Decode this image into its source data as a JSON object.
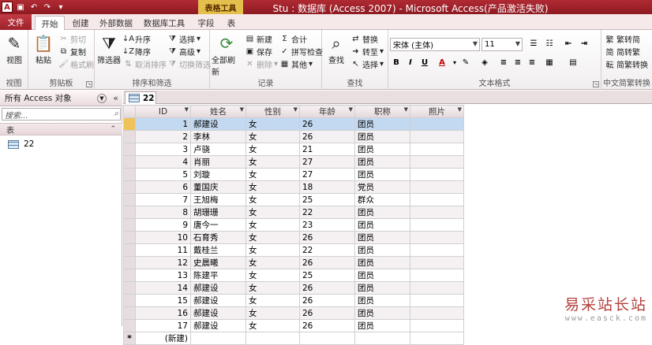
{
  "titlebar": {
    "context_tab": "表格工具",
    "title": "Stu : 数据库 (Access 2007) - Microsoft Access(产品激活失败)"
  },
  "tabs": [
    "文件",
    "开始",
    "创建",
    "外部数据",
    "数据库工具",
    "字段",
    "表"
  ],
  "ribbon": {
    "views": {
      "label": "视图",
      "btn": "视图"
    },
    "clipboard": {
      "label": "剪贴板",
      "paste": "粘贴",
      "cut": "剪切",
      "copy": "复制",
      "format_painter": "格式刷"
    },
    "sort_filter": {
      "label": "排序和筛选",
      "filter": "筛选器",
      "ascending": "升序",
      "descending": "降序",
      "remove_sort": "取消排序",
      "selection": "选择",
      "advanced": "高级",
      "toggle_filter": "切换筛选"
    },
    "records": {
      "label": "记录",
      "refresh_all": "全部刷新",
      "new": "新建",
      "save": "保存",
      "delete": "删除",
      "totals": "合计",
      "spelling": "拼写检查",
      "more": "其他"
    },
    "find": {
      "label": "查找",
      "find": "查找",
      "replace": "替换",
      "goto": "转至",
      "select": "选择"
    },
    "text_format": {
      "label": "文本格式",
      "font": "宋体 (主体)",
      "size": "11"
    },
    "chinese_conv": {
      "label": "中文简繁转换",
      "t2s": "繁转简",
      "s2t": "简转繁",
      "convert": "简繁转换"
    }
  },
  "navpane": {
    "header": "所有 Access 对象",
    "search_placeholder": "搜索...",
    "section": "表",
    "item": "22"
  },
  "document": {
    "tab": "22",
    "columns": [
      "ID",
      "姓名",
      "性别",
      "年龄",
      "职称",
      "照片"
    ],
    "rows": [
      [
        "1",
        "郝建设",
        "女",
        "26",
        "团员",
        ""
      ],
      [
        "2",
        "李林",
        "女",
        "26",
        "团员",
        ""
      ],
      [
        "3",
        "卢骁",
        "女",
        "21",
        "团员",
        ""
      ],
      [
        "4",
        "肖丽",
        "女",
        "27",
        "团员",
        ""
      ],
      [
        "5",
        "刘璇",
        "女",
        "27",
        "团员",
        ""
      ],
      [
        "6",
        "董国庆",
        "女",
        "18",
        "党员",
        ""
      ],
      [
        "7",
        "王旭梅",
        "女",
        "25",
        "群众",
        ""
      ],
      [
        "8",
        "胡珊珊",
        "女",
        "22",
        "团员",
        ""
      ],
      [
        "9",
        "唐今一",
        "女",
        "23",
        "团员",
        ""
      ],
      [
        "10",
        "石育秀",
        "女",
        "26",
        "团员",
        ""
      ],
      [
        "11",
        "戴桂兰",
        "女",
        "22",
        "团员",
        ""
      ],
      [
        "12",
        "史晨曦",
        "女",
        "26",
        "团员",
        ""
      ],
      [
        "13",
        "陈建平",
        "女",
        "25",
        "团员",
        ""
      ],
      [
        "14",
        "郝建设",
        "女",
        "26",
        "团员",
        ""
      ],
      [
        "15",
        "郝建设",
        "女",
        "26",
        "团员",
        ""
      ],
      [
        "16",
        "郝建设",
        "女",
        "26",
        "团员",
        ""
      ],
      [
        "17",
        "郝建设",
        "女",
        "26",
        "团员",
        ""
      ]
    ],
    "new_row_label": "(新建)"
  },
  "watermark": {
    "main": "易采站长站",
    "sub": "www.easck.com"
  }
}
